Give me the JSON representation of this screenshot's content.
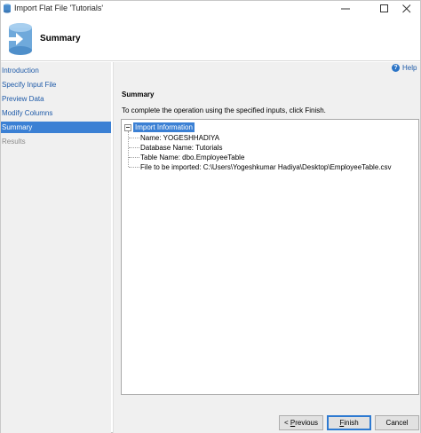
{
  "window": {
    "title": "Import Flat File 'Tutorials'"
  },
  "header": {
    "title": "Summary"
  },
  "nav": {
    "items": [
      {
        "label": "Introduction",
        "state": "normal"
      },
      {
        "label": "Specify Input File",
        "state": "normal"
      },
      {
        "label": "Preview Data",
        "state": "normal"
      },
      {
        "label": "Modify Columns",
        "state": "normal"
      },
      {
        "label": "Summary",
        "state": "selected"
      },
      {
        "label": "Results",
        "state": "disabled"
      }
    ]
  },
  "content": {
    "help_label": "Help",
    "section_title": "Summary",
    "instruction": "To complete the operation using the specified inputs, click Finish.",
    "tree": {
      "root_label": "Import Information",
      "items": [
        "Name: YOGESHHADIYA",
        "Database Name: Tutorials",
        "Table Name: dbo.EmployeeTable",
        "File to be imported: C:\\Users\\Yogeshkumar Hadiya\\Desktop\\EmployeeTable.csv"
      ]
    }
  },
  "buttons": {
    "previous_prefix": "< ",
    "previous_mnemonic": "P",
    "previous_rest": "revious",
    "finish_mnemonic": "F",
    "finish_rest": "inish",
    "cancel": "Cancel"
  },
  "colors": {
    "selection": "#3b80d4",
    "link": "#1e5aa8",
    "panel": "#f0f0f0"
  }
}
